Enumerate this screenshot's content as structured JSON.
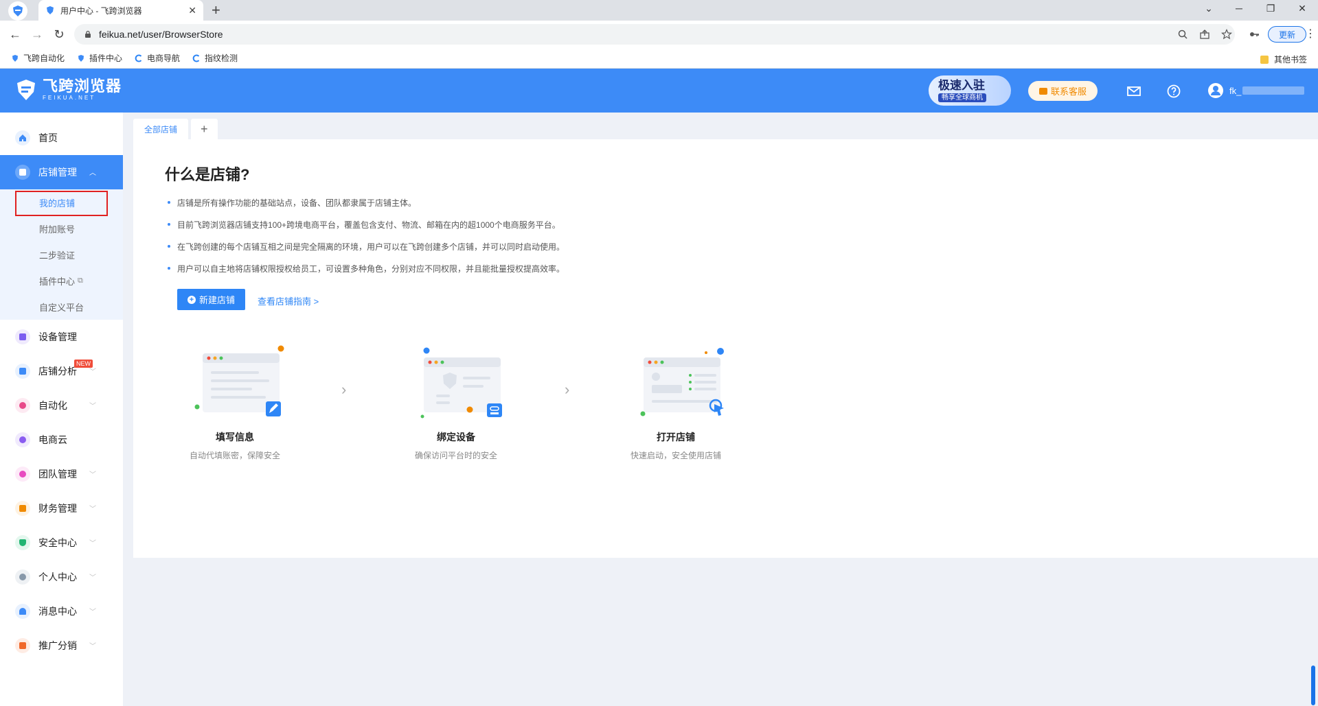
{
  "browser": {
    "tab_title": "用户中心 - 飞跨浏览器",
    "url": "feikua.net/user/BrowserStore",
    "update_label": "更新",
    "bookmarks": [
      "飞跨自动化",
      "插件中心",
      "电商导航",
      "指纹检测"
    ],
    "other_bookmarks": "其他书签"
  },
  "header": {
    "brand_name": "飞跨浏览器",
    "brand_sub": "FEIKUA.NET",
    "promo_title": "极速入驻",
    "promo_sub": "畅享全球商机",
    "contact_label": "联系客服",
    "user_name": "fk_",
    "colors": {
      "primary": "#3d8bf7",
      "promo_accent": "#f08a00"
    }
  },
  "sidebar": {
    "home": "首页",
    "store_mgmt": "店铺管理",
    "sub_items": [
      "我的店铺",
      "附加账号",
      "二步验证",
      "插件中心",
      "自定义平台"
    ],
    "items": [
      {
        "label": "设备管理",
        "icon": "device-icon",
        "color": "#7b5cf0"
      },
      {
        "label": "店铺分析",
        "icon": "analytics-icon",
        "color": "#3d8bf7",
        "badge": "NEW"
      },
      {
        "label": "自动化",
        "icon": "robot-icon",
        "color": "#e84a8a"
      },
      {
        "label": "电商云",
        "icon": "cloud-icon",
        "color": "#8a5cf0"
      },
      {
        "label": "团队管理",
        "icon": "team-icon",
        "color": "#e84ac0"
      },
      {
        "label": "财务管理",
        "icon": "wallet-icon",
        "color": "#f08a00"
      },
      {
        "label": "安全中心",
        "icon": "shield-icon",
        "color": "#22b573"
      },
      {
        "label": "个人中心",
        "icon": "user-icon",
        "color": "#8899aa"
      },
      {
        "label": "消息中心",
        "icon": "bell-icon",
        "color": "#3d8bf7"
      },
      {
        "label": "推广分销",
        "icon": "megaphone-icon",
        "color": "#f0682a"
      }
    ]
  },
  "content": {
    "tabs": [
      "全部店铺",
      "+"
    ],
    "title": "什么是店铺?",
    "bullets": [
      "店铺是所有操作功能的基础站点，设备、团队都隶属于店铺主体。",
      "目前飞跨浏览器店铺支持100+跨境电商平台，覆盖包含支付、物流、邮箱在内的超1000个电商服务平台。",
      "在飞跨创建的每个店铺互相之间是完全隔离的环境，用户可以在飞跨创建多个店铺，并可以同时启动使用。",
      "用户可以自主地将店铺权限授权给员工，可设置多种角色，分别对应不同权限，并且能批量授权提高效率。"
    ],
    "create_label": "新建店铺",
    "guide_label": "查看店铺指南 >",
    "steps": [
      {
        "title": "填写信息",
        "desc": "自动代填账密，保障安全"
      },
      {
        "title": "绑定设备",
        "desc": "确保访问平台时的安全"
      },
      {
        "title": "打开店铺",
        "desc": "快速启动，安全使用店铺"
      }
    ]
  }
}
